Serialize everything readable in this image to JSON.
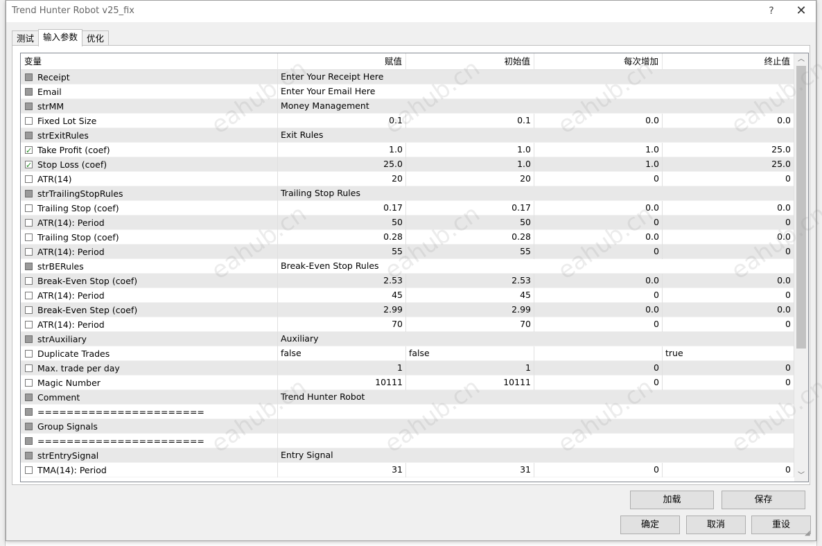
{
  "window": {
    "title": "Trend Hunter Robot v25_fix",
    "help_label": "?",
    "close_label": "✕"
  },
  "tabs": [
    {
      "label": "测试"
    },
    {
      "label": "输入参数"
    },
    {
      "label": "优化"
    }
  ],
  "grid": {
    "columns": [
      "变量",
      "赋值",
      "初始值",
      "每次增加",
      "终止值"
    ],
    "rows": [
      {
        "name": "Receipt",
        "check": "disabled",
        "span": true,
        "value": "Enter Your Receipt Here"
      },
      {
        "name": "Email",
        "check": "disabled",
        "span": true,
        "value": "Enter Your Email Here"
      },
      {
        "name": "strMM",
        "check": "disabled",
        "span": true,
        "value": "Money Management"
      },
      {
        "name": "Fixed Lot Size",
        "check": "off",
        "value": "0.1",
        "start": "0.1",
        "step": "0.0",
        "stop": "0.0"
      },
      {
        "name": "strExitRules",
        "check": "disabled",
        "span": true,
        "value": "Exit Rules"
      },
      {
        "name": "Take Profit (coef)",
        "check": "on",
        "value": "1.0",
        "start": "1.0",
        "step": "1.0",
        "stop": "25.0"
      },
      {
        "name": "Stop Loss (coef)",
        "check": "on",
        "value": "25.0",
        "start": "1.0",
        "step": "1.0",
        "stop": "25.0"
      },
      {
        "name": "ATR(14)",
        "check": "off",
        "value": "20",
        "start": "20",
        "step": "0",
        "stop": "0"
      },
      {
        "name": "strTrailingStopRules",
        "check": "disabled",
        "span": true,
        "value": "Trailing Stop Rules"
      },
      {
        "name": "Trailing Stop (coef)",
        "check": "off",
        "value": "0.17",
        "start": "0.17",
        "step": "0.0",
        "stop": "0.0"
      },
      {
        "name": "ATR(14): Period",
        "check": "off",
        "value": "50",
        "start": "50",
        "step": "0",
        "stop": "0"
      },
      {
        "name": "Trailing Stop (coef)",
        "check": "off",
        "value": "0.28",
        "start": "0.28",
        "step": "0.0",
        "stop": "0.0"
      },
      {
        "name": "ATR(14): Period",
        "check": "off",
        "value": "55",
        "start": "55",
        "step": "0",
        "stop": "0"
      },
      {
        "name": "strBERules",
        "check": "disabled",
        "span": true,
        "value": "Break-Even Stop Rules"
      },
      {
        "name": "Break-Even Stop (coef)",
        "check": "off",
        "value": "2.53",
        "start": "2.53",
        "step": "0.0",
        "stop": "0.0"
      },
      {
        "name": "ATR(14): Period",
        "check": "off",
        "value": "45",
        "start": "45",
        "step": "0",
        "stop": "0"
      },
      {
        "name": "Break-Even Step (coef)",
        "check": "off",
        "value": "2.99",
        "start": "2.99",
        "step": "0.0",
        "stop": "0.0"
      },
      {
        "name": "ATR(14): Period",
        "check": "off",
        "value": "70",
        "start": "70",
        "step": "0",
        "stop": "0"
      },
      {
        "name": "strAuxiliary",
        "check": "disabled",
        "span": true,
        "value": "Auxiliary"
      },
      {
        "name": "Duplicate Trades",
        "check": "off",
        "bool": true,
        "value": "false",
        "start": "false",
        "step": "",
        "stop": "true"
      },
      {
        "name": "Max. trade per day",
        "check": "off",
        "value": "1",
        "start": "1",
        "step": "0",
        "stop": "0"
      },
      {
        "name": "Magic Number",
        "check": "off",
        "value": "10111",
        "start": "10111",
        "step": "0",
        "stop": "0"
      },
      {
        "name": "Comment",
        "check": "disabled",
        "span": true,
        "value": "Trend Hunter Robot"
      },
      {
        "name": "=======================",
        "check": "disabled",
        "span": true,
        "value": ""
      },
      {
        "name": "Group Signals",
        "check": "disabled",
        "span": true,
        "value": ""
      },
      {
        "name": "=======================",
        "check": "disabled",
        "span": true,
        "value": ""
      },
      {
        "name": "strEntrySignal",
        "check": "disabled",
        "span": true,
        "value": "Entry Signal"
      },
      {
        "name": "TMA(14):  Period",
        "check": "off",
        "value": "31",
        "start": "31",
        "step": "0",
        "stop": "0"
      }
    ]
  },
  "buttons": {
    "load": "加载",
    "save": "保存",
    "ok": "确定",
    "cancel": "取消",
    "reset": "重设"
  },
  "watermark": "eahub.cn",
  "colors": {
    "alt_row": "#e8e8e8",
    "check_green": "#1a8a1a"
  }
}
